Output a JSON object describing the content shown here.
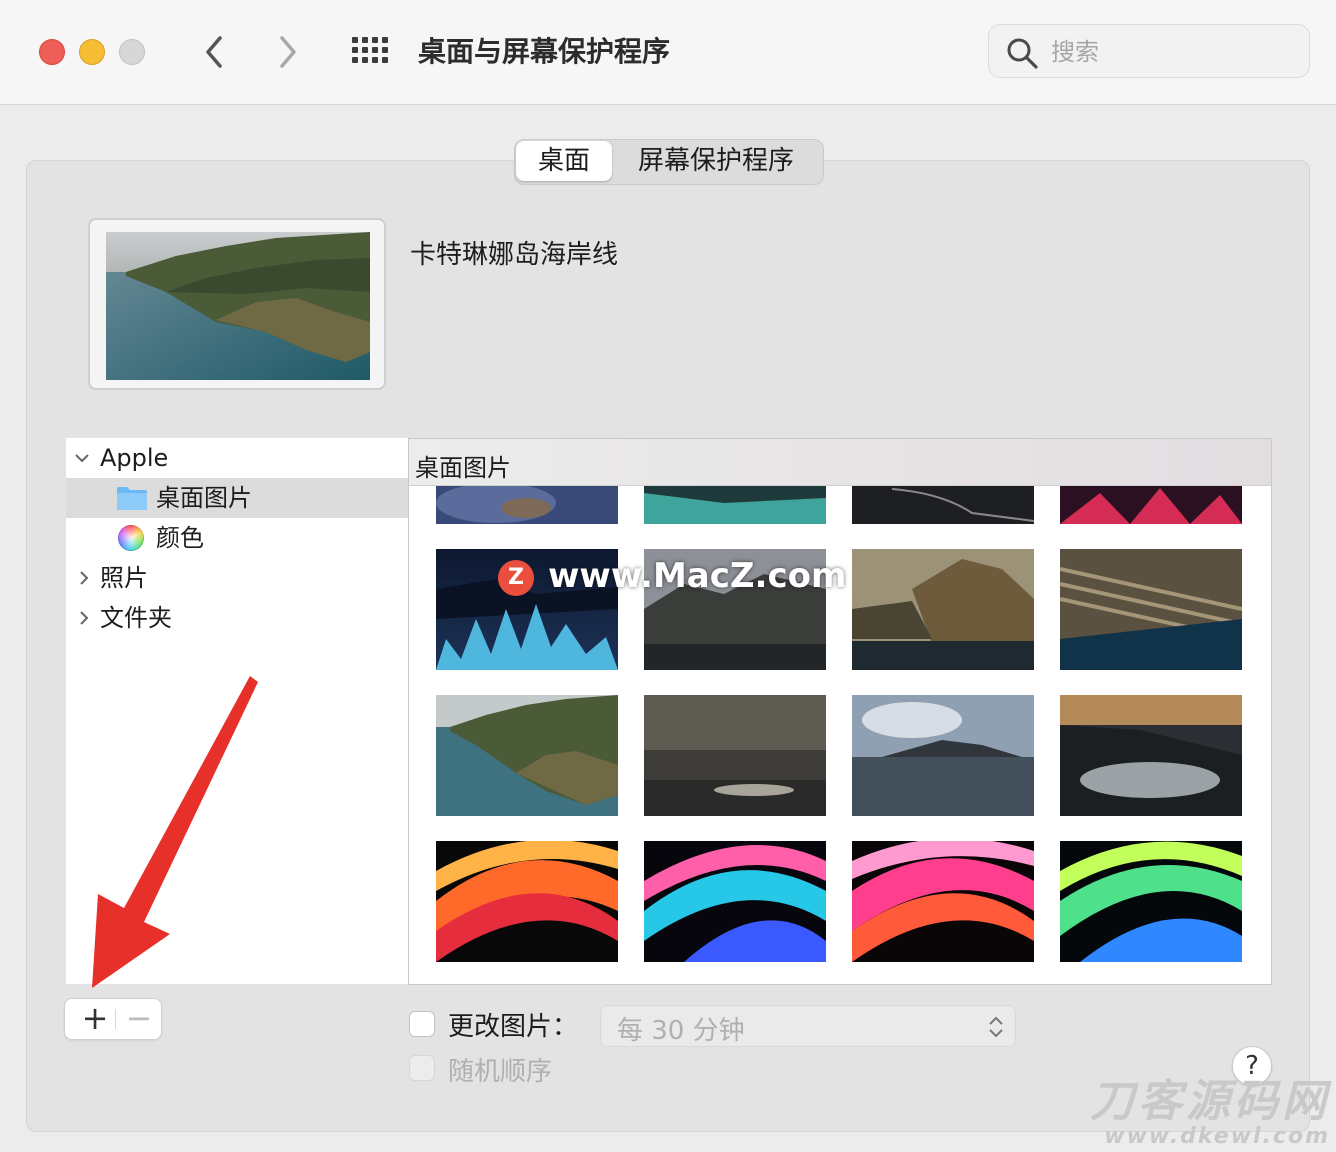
{
  "window": {
    "title": "桌面与屏幕保护程序",
    "search_placeholder": "搜索"
  },
  "tabs": [
    {
      "label": "桌面",
      "active": true
    },
    {
      "label": "屏幕保护程序",
      "active": false
    }
  ],
  "current_wallpaper": {
    "name": "卡特琳娜岛海岸线"
  },
  "sidebar": {
    "groups": [
      {
        "label": "Apple",
        "expanded": true,
        "children": [
          {
            "label": "桌面图片",
            "icon": "folder-icon",
            "selected": true
          },
          {
            "label": "颜色",
            "icon": "color-wheel-icon",
            "selected": false
          }
        ]
      },
      {
        "label": "照片",
        "expanded": false
      },
      {
        "label": "文件夹",
        "expanded": false
      }
    ]
  },
  "gallery": {
    "title": "桌面图片",
    "thumbnails": [
      "partial-rocks-blue",
      "partial-coast-teal",
      "partial-road-night",
      "partial-red-plant",
      "blue-grass-night",
      "cliffs-dusk-gray",
      "catalina-cliff-sunlit",
      "rock-strata-ocean",
      "catalina-coastline",
      "stormy-sea-light",
      "island-clouds-sea",
      "island-fog-sunset",
      "abstract-orange-red",
      "abstract-cyan-pink",
      "abstract-pink-red",
      "abstract-green-blue"
    ]
  },
  "controls": {
    "add_label": "+",
    "remove_label": "−",
    "change_picture_label": "更改图片：",
    "change_picture_checked": false,
    "interval_value": "每 30 分钟",
    "random_order_label": "随机顺序",
    "random_order_enabled": false,
    "help_label": "?"
  },
  "overlays": {
    "watermark_badge": "Z",
    "watermark_text": "www.MacZ.com",
    "corner_watermark": "刀客源码网",
    "corner_url": "www.dkewl.com"
  },
  "colors": {
    "close": "#ee5f57",
    "minimize": "#f5bd33",
    "accent_arrow": "#e8302a",
    "folder": "#6cb8f2"
  }
}
